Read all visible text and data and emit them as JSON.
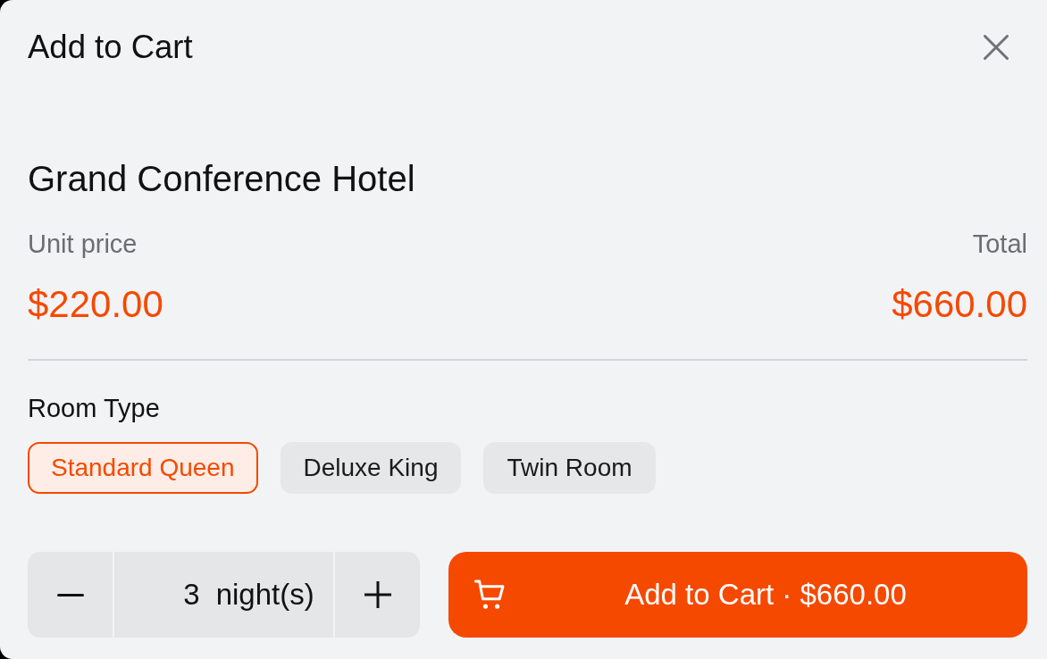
{
  "dialog": {
    "title": "Add to Cart"
  },
  "product": {
    "name": "Grand Conference Hotel",
    "unit_price_label": "Unit price",
    "unit_price": "$220.00",
    "total_label": "Total",
    "total": "$660.00"
  },
  "room_type": {
    "label": "Room Type",
    "options": [
      {
        "label": "Standard Queen",
        "selected": true
      },
      {
        "label": "Deluxe King",
        "selected": false
      },
      {
        "label": "Twin Room",
        "selected": false
      }
    ]
  },
  "quantity": {
    "value": "3",
    "unit": "night(s)"
  },
  "add_button": {
    "label": "Add to Cart · $660.00"
  }
}
